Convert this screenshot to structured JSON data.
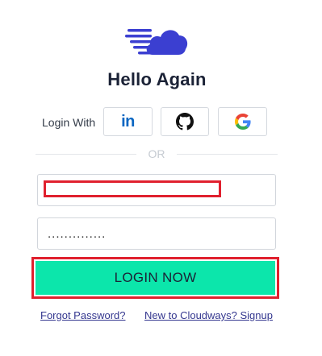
{
  "brand": {
    "logo_icon": "cloud-speed-logo-icon",
    "logo_color": "#3b3fd1"
  },
  "header": {
    "title": "Hello Again"
  },
  "social": {
    "label": "Login With",
    "buttons": [
      {
        "name": "linkedin",
        "icon": "linkedin-icon",
        "text": "in"
      },
      {
        "name": "github",
        "icon": "github-icon"
      },
      {
        "name": "google",
        "icon": "google-icon"
      }
    ]
  },
  "divider": {
    "text": "OR"
  },
  "form": {
    "email_value": "",
    "password_value": "..............",
    "submit_label": "LOGIN NOW"
  },
  "links": {
    "forgot": "Forgot Password?",
    "signup": "New to Cloudways? Signup"
  },
  "colors": {
    "accent": "#0ce6ab",
    "highlight": "#e0202e",
    "link": "#34378f"
  }
}
